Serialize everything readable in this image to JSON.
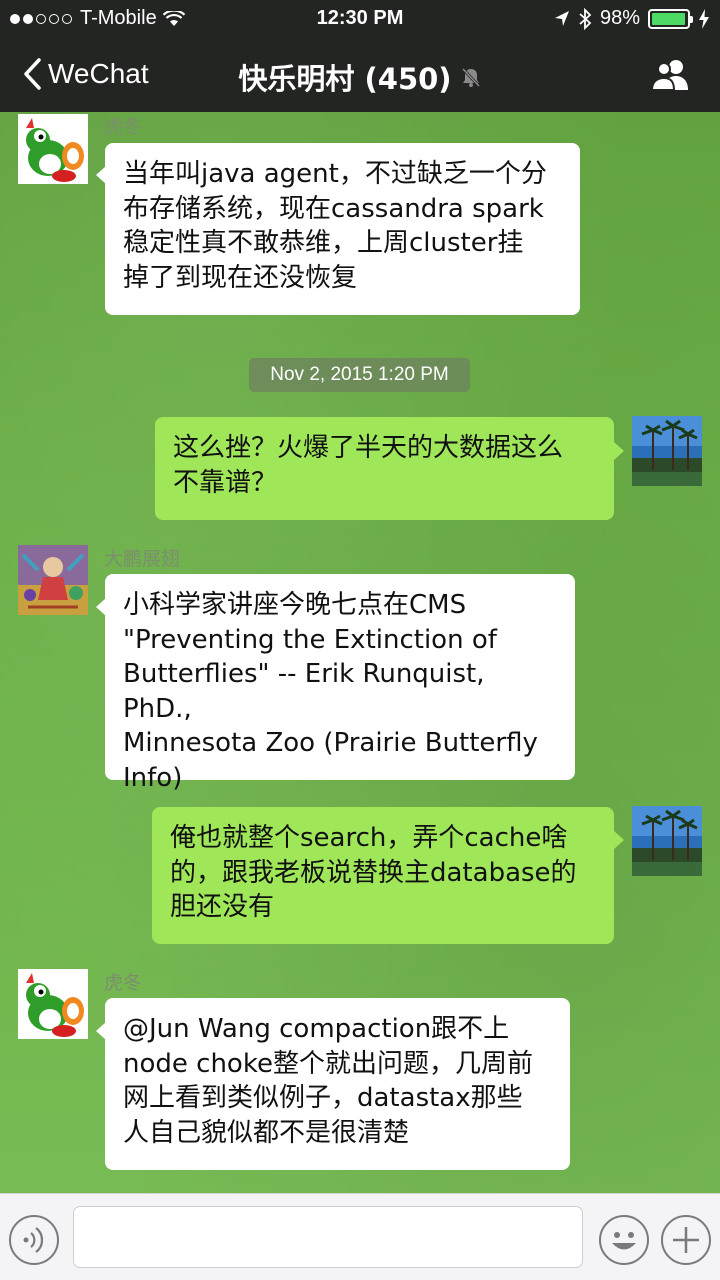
{
  "status_bar": {
    "carrier": "T-Mobile",
    "time": "12:30 PM",
    "battery": "98%",
    "battery_level": 0.98
  },
  "nav": {
    "back_label": "WeChat",
    "title": "快乐明村 (450)"
  },
  "timestamp": "Nov 2, 2015 1:20 PM",
  "messages": [
    {
      "direction": "in",
      "sender": "虎冬",
      "avatar": "yoshi-avatar",
      "lines": [
        "当年叫java agent，不过缺乏一个分",
        "布存储系统，现在cassandra spark",
        "稳定性真不敢恭维，上周cluster挂",
        "掉了到现在还没恢复"
      ]
    },
    {
      "direction": "out",
      "avatar": "palm-trees-avatar",
      "lines": [
        "这么挫？火爆了半天的大数据这么",
        "不靠谱？"
      ]
    },
    {
      "direction": "in",
      "sender": "大鹏展翅",
      "avatar": "painting-avatar",
      "lines": [
        "小科学家讲座今晚七点在CMS",
        "\"Preventing the Extinction of",
        "Butterflies\" -- Erik Runquist, PhD.,",
        "Minnesota Zoo (Prairie Butterfly",
        "Info)"
      ]
    },
    {
      "direction": "out",
      "avatar": "palm-trees-avatar",
      "lines": [
        "俺也就整个search，弄个cache啥",
        "的，跟我老板说替换主database的",
        "胆还没有"
      ]
    },
    {
      "direction": "in",
      "sender": "虎冬",
      "avatar": "yoshi-avatar",
      "lines": [
        "@Jun Wang compaction跟不上",
        "node choke整个就出问题，几周前",
        "网上看到类似例子，datastax那些",
        "人自己貌似都不是很清楚"
      ]
    }
  ],
  "input_bar": {
    "placeholder": "",
    "icons": [
      "voice-icon",
      "emoji-icon",
      "plus-icon"
    ]
  },
  "colors": {
    "bar_bg": "#232523",
    "incoming_bubble": "#ffffff",
    "outgoing_bubble": "#9fe659",
    "chat_bg": "#6aae46"
  }
}
